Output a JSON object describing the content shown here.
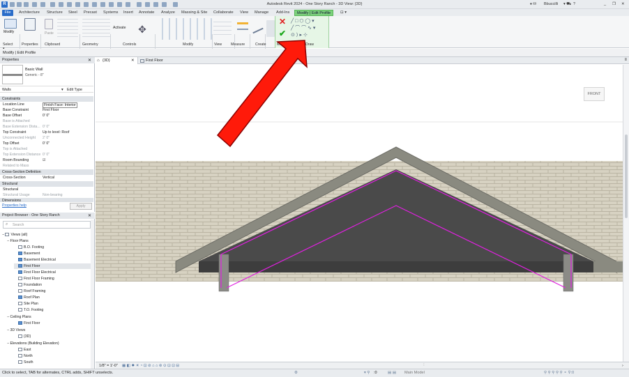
{
  "window": {
    "title": "Autodesk Revit 2024 - One Story Ranch - 3D View: {3D}",
    "user": "Bbuccilli",
    "help": "?",
    "logo": "R"
  },
  "ribbon_tabs": [
    "Architecture",
    "Structure",
    "Steel",
    "Precast",
    "Systems",
    "Insert",
    "Annotate",
    "Analyze",
    "Massing & Site",
    "Collaborate",
    "View",
    "Manage",
    "Add-Ins"
  ],
  "file_tab": "File",
  "context_tab": "Modify | Edit Profile",
  "ribbon": {
    "modify_btn": "Modify",
    "paste_btn": "Paste",
    "activate_btn": "Activate",
    "panels": {
      "select": "Select ▾",
      "properties": "Properties",
      "clipboard": "Clipboard",
      "geometry": "Geometry",
      "controls": "Controls",
      "modify": "Modify",
      "view": "View",
      "measure": "Measure",
      "create": "Create",
      "mode": "Mode",
      "draw": "Draw"
    }
  },
  "options_bar": "Modify | Edit Profile",
  "properties": {
    "header": "Properties",
    "type_name": "Basic Wall",
    "type_sub": "Generic - 8\"",
    "filter": "Walls",
    "edit_type": "Edit Type",
    "groups": {
      "constraints": "Constraints",
      "cross_section": "Cross-Section Definition",
      "structural": "Structural",
      "dimensions": "Dimensions"
    },
    "rows": [
      {
        "k": "Location Line",
        "v": "Finish Face: Interior"
      },
      {
        "k": "Base Constraint",
        "v": "First Floor"
      },
      {
        "k": "Base Offset",
        "v": "0'  0\""
      },
      {
        "k": "Base is Attached",
        "v": ""
      },
      {
        "k": "Base Extension Dista...",
        "v": "0'  0\""
      },
      {
        "k": "Top Constraint",
        "v": "Up to level: Roof"
      },
      {
        "k": "Unconnected Height",
        "v": "2'  0\""
      },
      {
        "k": "Top Offset",
        "v": "0'  0\""
      },
      {
        "k": "Top is Attached",
        "v": ""
      },
      {
        "k": "Top Extension Distance",
        "v": "0'  0\""
      },
      {
        "k": "Room Bounding",
        "v": "☑"
      },
      {
        "k": "Related to Mass",
        "v": ""
      }
    ],
    "cross_rows": [
      {
        "k": "Cross-Section",
        "v": "Vertical"
      }
    ],
    "structural_rows": [
      {
        "k": "Structural",
        "v": ""
      },
      {
        "k": "Structural Usage",
        "v": "Non-bearing"
      }
    ],
    "help_link": "Properties help",
    "apply": "Apply"
  },
  "browser": {
    "header": "Project Browser - One Story Ranch",
    "search_placeholder": "Search",
    "views_root": "Views (all)",
    "floor_plans": "Floor Plans",
    "floor_items": [
      "B.O. Footing",
      "Basement",
      "Basement Electrical",
      "First Floor",
      "First Floor Electrical",
      "First Floor Framing",
      "Foundation",
      "Roof Framing",
      "Roof Plan",
      "Site Plan",
      "T.O. Footing"
    ],
    "ceiling_plans": "Ceiling Plans",
    "ceiling_items": [
      "First Floor"
    ],
    "views_3d": "3D Views",
    "items_3d": [
      "{3D}"
    ],
    "elevations": "Elevations (Building Elevation)",
    "elevation_items": [
      "East",
      "North",
      "South"
    ]
  },
  "view_tabs": [
    {
      "label": "{3D}"
    },
    {
      "label": "First Floor"
    }
  ],
  "viewcube_label": "FRONT",
  "view_bar": {
    "scale": "1/8\" = 1'-0\""
  },
  "status": {
    "hint": "Click to select, TAB for alternates, CTRL adds, SHIFT unselects.",
    "model": "Main Model",
    "count": ":0"
  },
  "colors": {
    "arrow": "#ff1a0a",
    "profile_line": "#e020e0",
    "context_tab": "#7dd27d",
    "brick": "#d7d2c2",
    "roof_fill": "#4a4a4a",
    "fascia": "#8a8a80"
  }
}
